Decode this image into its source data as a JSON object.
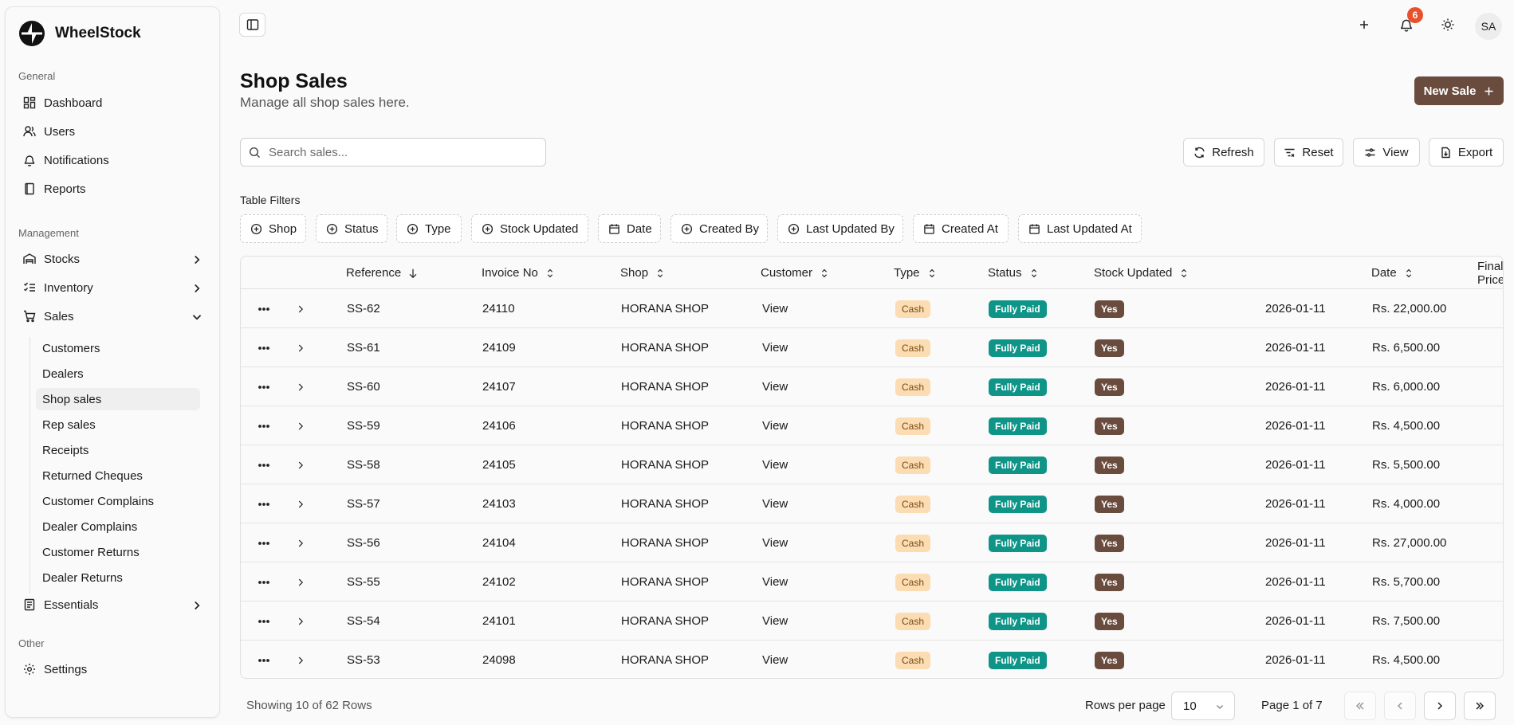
{
  "brand": {
    "name": "WheelStock"
  },
  "sidebar": {
    "general_label": "General",
    "general": [
      {
        "label": "Dashboard",
        "icon": "dashboard-icon"
      },
      {
        "label": "Users",
        "icon": "users-icon"
      },
      {
        "label": "Notifications",
        "icon": "bell-icon"
      },
      {
        "label": "Reports",
        "icon": "reports-icon"
      }
    ],
    "management_label": "Management",
    "management": [
      {
        "label": "Stocks",
        "icon": "warehouse-icon",
        "expanded": false
      },
      {
        "label": "Inventory",
        "icon": "list-check-icon",
        "expanded": false
      },
      {
        "label": "Sales",
        "icon": "cart-icon",
        "expanded": true
      }
    ],
    "sales_sub": [
      "Customers",
      "Dealers",
      "Shop sales",
      "Rep sales",
      "Receipts",
      "Returned Cheques",
      "Customer Complains",
      "Dealer Complains",
      "Customer Returns",
      "Dealer Returns"
    ],
    "active_sub": "Shop sales",
    "essentials": {
      "label": "Essentials",
      "icon": "book-icon"
    },
    "other_label": "Other",
    "settings": {
      "label": "Settings",
      "icon": "gear-icon"
    }
  },
  "header": {
    "notification_count": "6",
    "avatar_initials": "SA"
  },
  "page": {
    "title": "Shop Sales",
    "subtitle": "Manage all shop sales here.",
    "new_button": "New Sale"
  },
  "search": {
    "placeholder": "Search sales..."
  },
  "toolbar": {
    "refresh": "Refresh",
    "reset": "Reset",
    "view": "View",
    "export": "Export"
  },
  "filters": {
    "label": "Table Filters",
    "chips": [
      {
        "label": "Shop",
        "icon": "plus-circle-icon"
      },
      {
        "label": "Status",
        "icon": "plus-circle-icon"
      },
      {
        "label": "Type",
        "icon": "plus-circle-icon"
      },
      {
        "label": "Stock Updated",
        "icon": "plus-circle-icon"
      },
      {
        "label": "Date",
        "icon": "calendar-icon"
      },
      {
        "label": "Created By",
        "icon": "plus-circle-icon"
      },
      {
        "label": "Last Updated By",
        "icon": "plus-circle-icon"
      },
      {
        "label": "Created At",
        "icon": "calendar-icon"
      },
      {
        "label": "Last Updated At",
        "icon": "calendar-icon"
      }
    ]
  },
  "table": {
    "columns": [
      "Reference",
      "Invoice No",
      "Shop",
      "Customer",
      "Type",
      "Status",
      "Stock Updated",
      "Date",
      "Final Price"
    ],
    "sort_column": "Reference",
    "sort_direction": "desc",
    "rows": [
      {
        "reference": "SS-62",
        "invoice": "24110",
        "shop": "HORANA SHOP",
        "customer": "View",
        "type": "Cash",
        "status": "Fully Paid",
        "stock_updated": "Yes",
        "date": "2026-01-11",
        "price": "Rs. 22,000.00"
      },
      {
        "reference": "SS-61",
        "invoice": "24109",
        "shop": "HORANA SHOP",
        "customer": "View",
        "type": "Cash",
        "status": "Fully Paid",
        "stock_updated": "Yes",
        "date": "2026-01-11",
        "price": "Rs. 6,500.00"
      },
      {
        "reference": "SS-60",
        "invoice": "24107",
        "shop": "HORANA SHOP",
        "customer": "View",
        "type": "Cash",
        "status": "Fully Paid",
        "stock_updated": "Yes",
        "date": "2026-01-11",
        "price": "Rs. 6,000.00"
      },
      {
        "reference": "SS-59",
        "invoice": "24106",
        "shop": "HORANA SHOP",
        "customer": "View",
        "type": "Cash",
        "status": "Fully Paid",
        "stock_updated": "Yes",
        "date": "2026-01-11",
        "price": "Rs. 4,500.00"
      },
      {
        "reference": "SS-58",
        "invoice": "24105",
        "shop": "HORANA SHOP",
        "customer": "View",
        "type": "Cash",
        "status": "Fully Paid",
        "stock_updated": "Yes",
        "date": "2026-01-11",
        "price": "Rs. 5,500.00"
      },
      {
        "reference": "SS-57",
        "invoice": "24103",
        "shop": "HORANA SHOP",
        "customer": "View",
        "type": "Cash",
        "status": "Fully Paid",
        "stock_updated": "Yes",
        "date": "2026-01-11",
        "price": "Rs. 4,000.00"
      },
      {
        "reference": "SS-56",
        "invoice": "24104",
        "shop": "HORANA SHOP",
        "customer": "View",
        "type": "Cash",
        "status": "Fully Paid",
        "stock_updated": "Yes",
        "date": "2026-01-11",
        "price": "Rs. 27,000.00"
      },
      {
        "reference": "SS-55",
        "invoice": "24102",
        "shop": "HORANA SHOP",
        "customer": "View",
        "type": "Cash",
        "status": "Fully Paid",
        "stock_updated": "Yes",
        "date": "2026-01-11",
        "price": "Rs. 5,700.00"
      },
      {
        "reference": "SS-54",
        "invoice": "24101",
        "shop": "HORANA SHOP",
        "customer": "View",
        "type": "Cash",
        "status": "Fully Paid",
        "stock_updated": "Yes",
        "date": "2026-01-11",
        "price": "Rs. 7,500.00"
      },
      {
        "reference": "SS-53",
        "invoice": "24098",
        "shop": "HORANA SHOP",
        "customer": "View",
        "type": "Cash",
        "status": "Fully Paid",
        "stock_updated": "Yes",
        "date": "2026-01-11",
        "price": "Rs. 4,500.00"
      }
    ]
  },
  "pagination": {
    "showing": "Showing 10 of 62 Rows",
    "rows_per_page_label": "Rows per page",
    "rows_per_page": "10",
    "page_info": "Page 1 of 7"
  },
  "colors": {
    "accent": "#6a4c3e",
    "paid": "#0f9488",
    "cash": "#fbdcb3",
    "badge": "#e8512c"
  }
}
